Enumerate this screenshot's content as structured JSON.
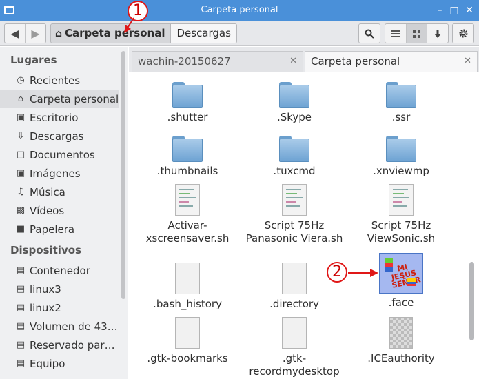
{
  "window": {
    "title": "Carpeta personal",
    "minimize": "–",
    "maximize": "□",
    "close": "✕"
  },
  "toolbar": {
    "back": "◀",
    "forward": "▶",
    "path": [
      "Carpeta personal",
      "Descargas"
    ],
    "search_icon": "search-icon",
    "view_list_icon": "list-view-icon",
    "view_grid_icon": "grid-view-icon",
    "view_down_icon": "arrow-down-icon",
    "gear_icon": "gear-icon"
  },
  "sidebar": {
    "headers": [
      "Lugares",
      "Dispositivos"
    ],
    "places": [
      {
        "label": "Recientes",
        "icon": "clock-icon"
      },
      {
        "label": "Carpeta personal",
        "icon": "home-icon"
      },
      {
        "label": "Escritorio",
        "icon": "desktop-icon"
      },
      {
        "label": "Descargas",
        "icon": "download-icon"
      },
      {
        "label": "Documentos",
        "icon": "document-icon"
      },
      {
        "label": "Imágenes",
        "icon": "camera-icon"
      },
      {
        "label": "Música",
        "icon": "music-icon"
      },
      {
        "label": "Vídeos",
        "icon": "film-icon"
      },
      {
        "label": "Papelera",
        "icon": "trash-icon"
      }
    ],
    "devices": [
      {
        "label": "Contenedor",
        "icon": "drive-icon"
      },
      {
        "label": "linux3",
        "icon": "drive-icon"
      },
      {
        "label": "linux2",
        "icon": "drive-icon"
      },
      {
        "label": "Volumen de 43…",
        "icon": "drive-icon"
      },
      {
        "label": "Reservado par…",
        "icon": "drive-icon"
      },
      {
        "label": "Equipo",
        "icon": "drive-icon"
      }
    ]
  },
  "tabs": [
    {
      "label": "wachin-20150627",
      "close": "✕"
    },
    {
      "label": "Carpeta personal",
      "close": "✕"
    }
  ],
  "files": [
    {
      "name": ".shutter",
      "type": "folder"
    },
    {
      "name": ".Skype",
      "type": "folder"
    },
    {
      "name": ".ssr",
      "type": "folder"
    },
    {
      "name": ".thumbnails",
      "type": "folder"
    },
    {
      "name": ".tuxcmd",
      "type": "folder"
    },
    {
      "name": ".xnviewmp",
      "type": "folder"
    },
    {
      "name": "Activar-\nxscreensaver.sh",
      "type": "script"
    },
    {
      "name": "Script 75Hz\nPanasonic Viera.sh",
      "type": "script"
    },
    {
      "name": "Script 75Hz\nViewSonic.sh",
      "type": "script"
    },
    {
      "name": ".bash_history",
      "type": "text"
    },
    {
      "name": ".directory",
      "type": "text"
    },
    {
      "name": ".face",
      "type": "image"
    },
    {
      "name": ".gtk-bookmarks",
      "type": "text"
    },
    {
      "name": ".gtk-\nrecordmydesktop",
      "type": "text"
    },
    {
      "name": ".ICEauthority",
      "type": "binary"
    }
  ],
  "face_image_text": "MI JESÚS SEÑOR",
  "annotations": [
    "1",
    "2"
  ],
  "accent": "#4a90d9",
  "annotation_color": "#e01818"
}
